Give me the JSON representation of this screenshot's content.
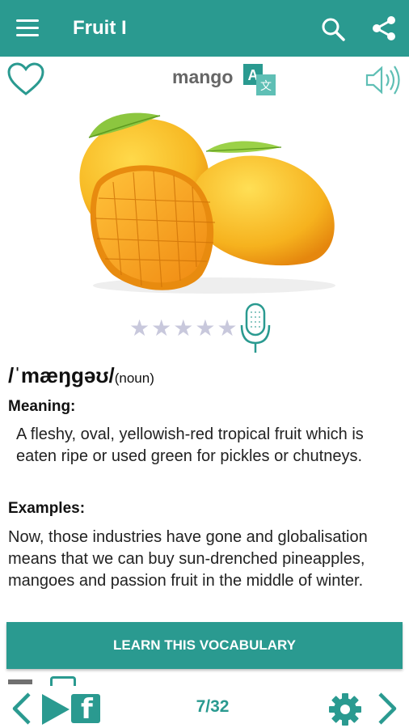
{
  "appbar": {
    "title": "Fruit I",
    "icons": [
      "menu-icon",
      "search-icon",
      "share-icon"
    ]
  },
  "word_header": {
    "word": "mango",
    "icons": [
      "heart-icon",
      "translate-icon",
      "speaker-icon"
    ]
  },
  "rating": {
    "stars": [
      "★",
      "★",
      "★",
      "★",
      "★"
    ],
    "filled": 0,
    "max": 5
  },
  "entry": {
    "ipa": "/ˈmæŋɡəʊ/",
    "part_of_speech": "(noun)",
    "meaning_label": "Meaning:",
    "meaning": "A fleshy, oval, yellowish-red tropical fruit which is eaten ripe or used green for pickles or chutneys.",
    "examples_label": "Examples:",
    "example": "Now, those industries have gone and globalisation means that we can buy sun-drenched pineapples, mangoes and passion fruit in the middle of winter."
  },
  "learn_button": {
    "label": "LEARN THIS VOCABULARY"
  },
  "bottom_bar": {
    "page": "7/32",
    "icons": [
      "prev-icon",
      "play-icon",
      "facebook-icon",
      "settings-icon",
      "next-icon"
    ]
  },
  "colors": {
    "accent": "#2a9a90",
    "star_empty": "#c8c8dc",
    "mango_yellow": "#f7b924",
    "leaf_green": "#8cc63f"
  }
}
